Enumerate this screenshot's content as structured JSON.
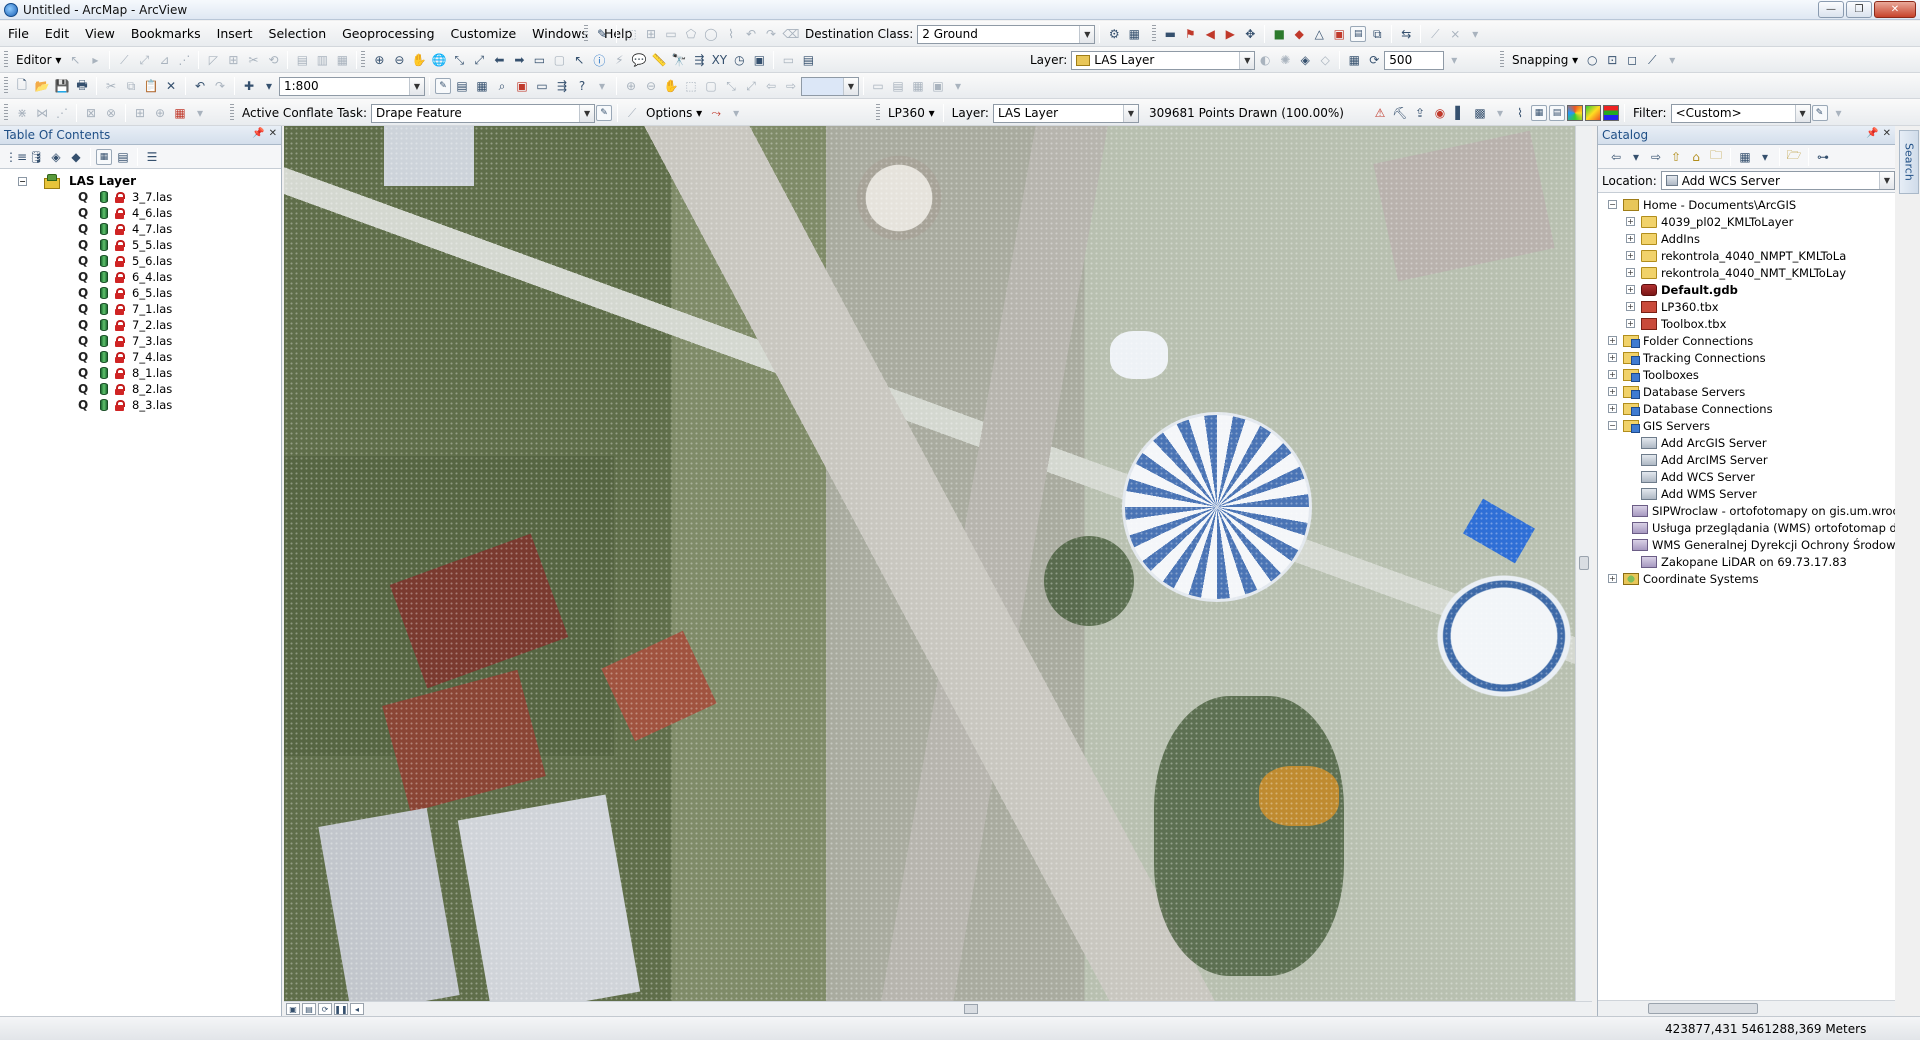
{
  "window": {
    "title": "Untitled - ArcMap - ArcView",
    "minimize": "—",
    "maximize": "❐",
    "close": "✕"
  },
  "menu": [
    "File",
    "Edit",
    "View",
    "Bookmarks",
    "Insert",
    "Selection",
    "Geoprocessing",
    "Customize",
    "Windows",
    "Help"
  ],
  "toolbar_top": {
    "destination_class_label": "Destination Class:",
    "destination_class_value": "2  Ground"
  },
  "toolbar_editor": {
    "editor_label": "Editor ▾",
    "layer_label": "Layer:",
    "layer_value": "LAS Layer",
    "spin_value": "500",
    "snapping_label": "Snapping ▾"
  },
  "toolbar_standard": {
    "scale_value": "1:800"
  },
  "toolbar_conflate": {
    "task_label": "Active Conflate Task:",
    "task_value": "Drape Feature",
    "options_label": "Options ▾",
    "lp360_label": "LP360 ▾",
    "layer_label": "Layer:",
    "layer_value": "LAS Layer",
    "points_drawn": "309681 Points Drawn (100.00%)",
    "filter_label": "Filter:",
    "filter_value": "<Custom>"
  },
  "colors": {
    "accent": "#1f4f86",
    "lock": "#d02424",
    "cylinder": "#3aa24f"
  },
  "toc": {
    "title": "Table Of Contents",
    "pin": "📌",
    "close": "✕",
    "group": "LAS Layer",
    "layers": [
      "3_7.las",
      "4_6.las",
      "4_7.las",
      "5_5.las",
      "5_6.las",
      "6_4.las",
      "6_5.las",
      "7_1.las",
      "7_2.las",
      "7_3.las",
      "7_4.las",
      "8_1.las",
      "8_2.las",
      "8_3.las"
    ]
  },
  "catalog": {
    "title": "Catalog",
    "pin": "📌",
    "close": "✕",
    "location_label": "Location:",
    "location_value": "Add WCS Server",
    "home": "Home - Documents\\ArcGIS",
    "home_children": [
      {
        "label": "4039_pl02_KMLToLayer",
        "icon": "folder",
        "bold": false
      },
      {
        "label": "AddIns",
        "icon": "folder",
        "bold": false
      },
      {
        "label": "rekontrola_4040_NMPT_KMLToLa",
        "icon": "folder",
        "bold": false
      },
      {
        "label": "rekontrola_4040_NMT_KMLToLay",
        "icon": "folder",
        "bold": false
      },
      {
        "label": "Default.gdb",
        "icon": "gdb",
        "bold": true
      },
      {
        "label": "LP360.tbx",
        "icon": "tbx",
        "bold": false
      },
      {
        "label": "Toolbox.tbx",
        "icon": "tbx",
        "bold": false
      }
    ],
    "roots": [
      {
        "label": "Folder Connections",
        "icon": "conn"
      },
      {
        "label": "Tracking Connections",
        "icon": "conn"
      },
      {
        "label": "Toolboxes",
        "icon": "conn"
      },
      {
        "label": "Database Servers",
        "icon": "conn"
      },
      {
        "label": "Database Connections",
        "icon": "conn"
      }
    ],
    "gis_servers": "GIS Servers",
    "gis_children": [
      {
        "label": "Add ArcGIS Server",
        "icon": "server"
      },
      {
        "label": "Add ArcIMS Server",
        "icon": "server"
      },
      {
        "label": "Add WCS Server",
        "icon": "server"
      },
      {
        "label": "Add WMS Server",
        "icon": "server"
      },
      {
        "label": "SIPWroclaw - ortofotomapy on gis.um.wroc",
        "icon": "wms"
      },
      {
        "label": "Usługa przeglądania (WMS) ortofotomap dla",
        "icon": "wms"
      },
      {
        "label": "WMS Generalnej Dyrekcji Ochrony Środowis",
        "icon": "wms"
      },
      {
        "label": "Zakopane LiDAR on 69.73.17.83",
        "icon": "wms"
      }
    ],
    "coord_systems": "Coordinate Systems"
  },
  "search_tab": "Search",
  "status": {
    "coordinates": "423877,431  5461288,369 Meters"
  }
}
